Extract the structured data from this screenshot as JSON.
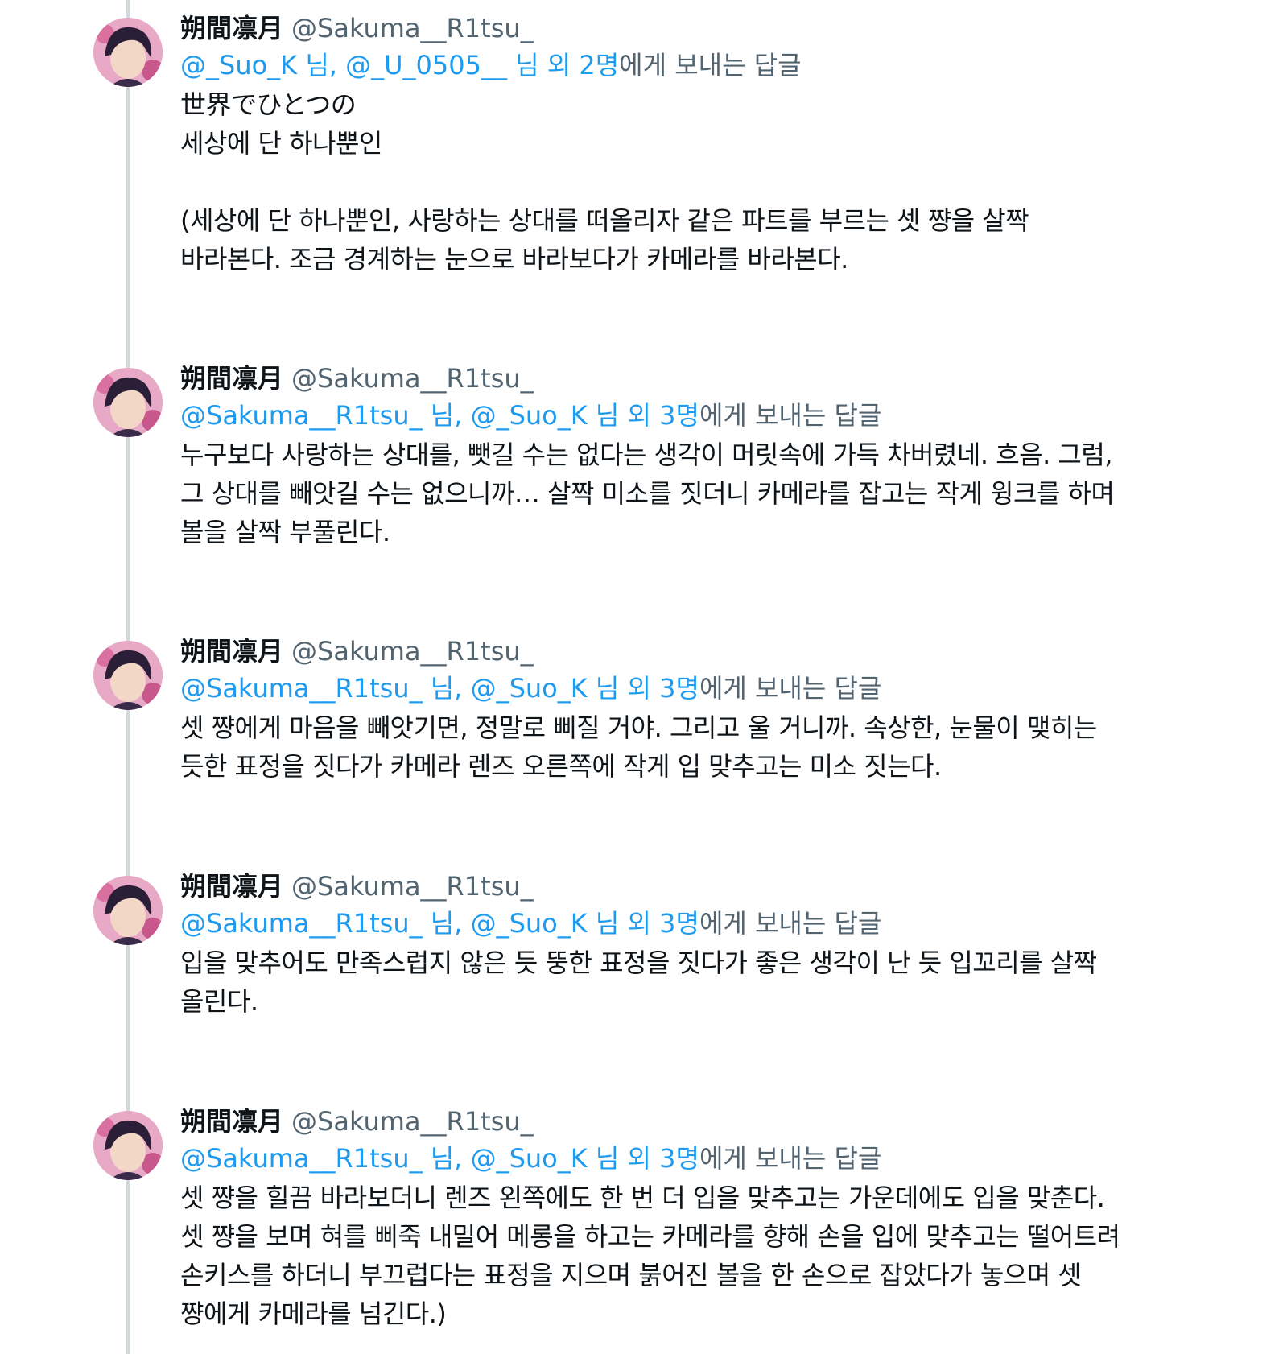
{
  "colors": {
    "link": "#1d9bf0",
    "secondary_text": "#536471",
    "primary_text": "#0f1419",
    "thread_line": "#cfd9de"
  },
  "tweets": [
    {
      "display_name": "朔間凛月",
      "handle": "@Sakuma__R1tsu_",
      "reply_users": "@_Suo_K 님, @_U_0505__ 님 외 2명",
      "reply_suffix": "에게 보내는 답글",
      "text": "世界でひとつの\n세상에 단 하나뿐인\n\n(세상에 단 하나뿐인, 사랑하는 상대를 떠올리자 같은 파트를 부르는 셋 쨩을 살짝\n바라본다. 조금 경계하는 눈으로 바라보다가 카메라를 바라본다."
    },
    {
      "display_name": "朔間凛月",
      "handle": "@Sakuma__R1tsu_",
      "reply_users": "@Sakuma__R1tsu_ 님, @_Suo_K 님 외 3명",
      "reply_suffix": "에게 보내는 답글",
      "text": "누구보다 사랑하는 상대를, 뺏길 수는 없다는 생각이 머릿속에 가득 차버렸네. 흐음. 그럼,\n그 상대를 빼앗길 수는 없으니까… 살짝 미소를 짓더니 카메라를 잡고는 작게 윙크를 하며\n볼을 살짝 부풀린다."
    },
    {
      "display_name": "朔間凛月",
      "handle": "@Sakuma__R1tsu_",
      "reply_users": "@Sakuma__R1tsu_ 님, @_Suo_K 님 외 3명",
      "reply_suffix": "에게 보내는 답글",
      "text": "셋 쨩에게 마음을 빼앗기면, 정말로 삐질 거야. 그리고 울 거니까. 속상한, 눈물이 맺히는\n듯한 표정을 짓다가 카메라 렌즈 오른쪽에 작게 입 맞추고는 미소 짓는다."
    },
    {
      "display_name": "朔間凛月",
      "handle": "@Sakuma__R1tsu_",
      "reply_users": "@Sakuma__R1tsu_ 님, @_Suo_K 님 외 3명",
      "reply_suffix": "에게 보내는 답글",
      "text": "입을 맞추어도 만족스럽지 않은 듯 뚱한 표정을 짓다가 좋은 생각이 난 듯 입꼬리를 살짝\n올린다."
    },
    {
      "display_name": "朔間凛月",
      "handle": "@Sakuma__R1tsu_",
      "reply_users": "@Sakuma__R1tsu_ 님, @_Suo_K 님 외 3명",
      "reply_suffix": "에게 보내는 답글",
      "text": "셋 쨩을 힐끔 바라보더니 렌즈 왼쪽에도 한 번 더 입을 맞추고는 가운데에도 입을 맞춘다.\n셋 쨩을 보며 혀를 삐죽 내밀어 메롱을 하고는 카메라를 향해 손을 입에 맞추고는 떨어트려\n손키스를 하더니 부끄럽다는 표정을 지으며 붉어진 볼을 한 손으로 잡았다가 놓으며 셋\n쨩에게 카메라를 넘긴다.)"
    }
  ]
}
